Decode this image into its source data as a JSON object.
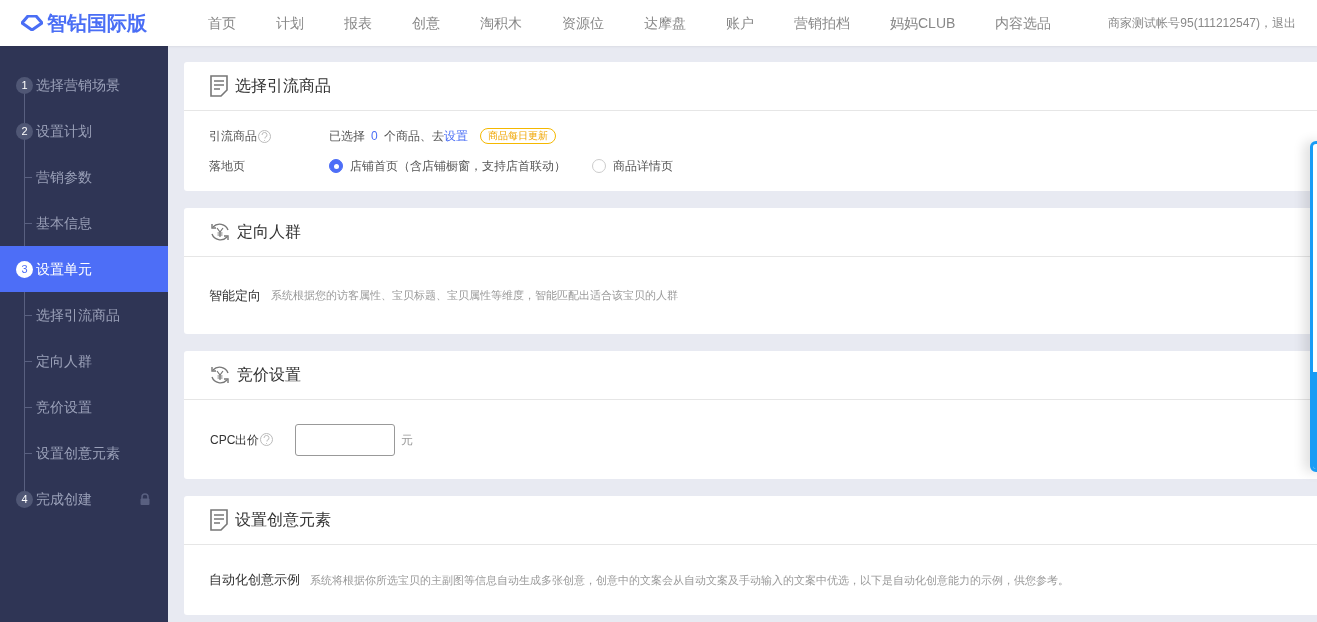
{
  "header": {
    "logo": "智钻国际版",
    "nav": [
      {
        "label": "首页",
        "selected": false
      },
      {
        "label": "计划",
        "selected": false
      },
      {
        "label": "报表",
        "selected": false
      },
      {
        "label": "创意",
        "selected": false
      },
      {
        "label": "淘积木",
        "selected": false
      },
      {
        "label": "资源位",
        "selected": false
      },
      {
        "label": "达摩盘",
        "selected": false
      },
      {
        "label": "账户",
        "selected": false
      },
      {
        "label": "营销拍档",
        "selected": false
      },
      {
        "label": "妈妈CLUB",
        "selected": false
      },
      {
        "label": "内容选品",
        "selected": false
      }
    ],
    "account": "商家测试帐号95(111212547)，退出"
  },
  "sidebar": {
    "items": [
      {
        "kind": "step",
        "number": "1",
        "label": "选择营销场景",
        "selected": false,
        "locked": false
      },
      {
        "kind": "step",
        "number": "2",
        "label": "设置计划",
        "selected": false,
        "locked": false
      },
      {
        "kind": "sub",
        "label": "营销参数",
        "selected": false
      },
      {
        "kind": "sub",
        "label": "基本信息",
        "selected": false
      },
      {
        "kind": "step",
        "number": "3",
        "label": "设置单元",
        "selected": true,
        "locked": false
      },
      {
        "kind": "sub",
        "label": "选择引流商品",
        "selected": false
      },
      {
        "kind": "sub",
        "label": "定向人群",
        "selected": false
      },
      {
        "kind": "sub",
        "label": "竞价设置",
        "selected": false
      },
      {
        "kind": "sub",
        "label": "设置创意元素",
        "selected": false
      },
      {
        "kind": "step",
        "number": "4",
        "label": "完成创建",
        "selected": false,
        "locked": true
      }
    ]
  },
  "sections": [
    {
      "kind": "product",
      "title": "选择引流商品",
      "product_label": "引流商品",
      "selected_prefix": "已选择",
      "selected_count": "0",
      "selected_suffix": "个商品、去",
      "set_link": "设置",
      "badge": "商品每日更新",
      "landing_label": "落地页",
      "landing_options": [
        {
          "label": "店铺首页（含店铺橱窗，支持店首联动）",
          "selected": true
        },
        {
          "label": "商品详情页",
          "selected": false
        }
      ]
    },
    {
      "kind": "audience",
      "title": "定向人群",
      "label": "智能定向",
      "description": "系统根据您的访客属性、宝贝标题、宝贝属性等维度，智能匹配出适合该宝贝的人群"
    },
    {
      "kind": "bid",
      "title": "竞价设置",
      "label": "CPC出价",
      "unit": "元"
    },
    {
      "kind": "creative",
      "title": "设置创意元素",
      "label": "自动化创意示例",
      "description": "系统将根据你所选宝贝的主副图等信息自动生成多张创意，创意中的文案会从自动文案及手动输入的文案中优选，以下是自动化创意能力的示例，供您参考。"
    }
  ]
}
